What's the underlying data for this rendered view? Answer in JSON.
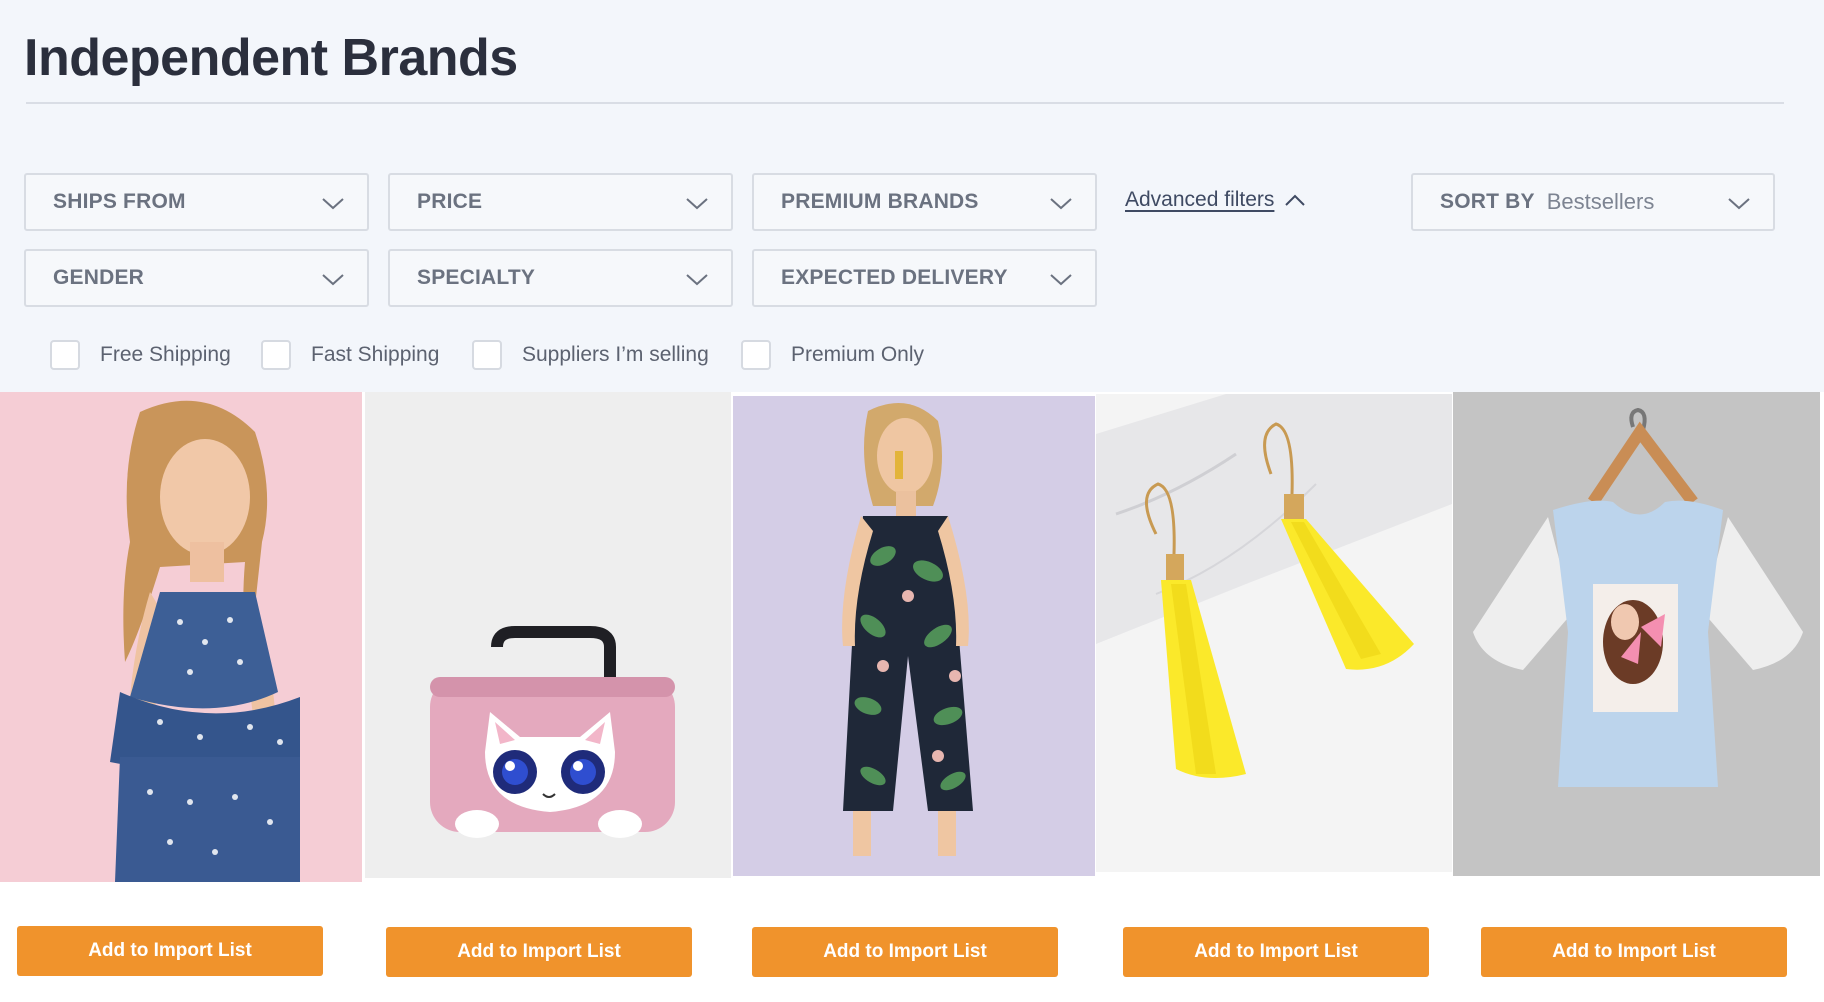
{
  "page": {
    "title": "Independent Brands"
  },
  "filters": {
    "row1": [
      {
        "label": "SHIPS FROM"
      },
      {
        "label": "PRICE"
      },
      {
        "label": "PREMIUM BRANDS"
      }
    ],
    "row2": [
      {
        "label": "GENDER"
      },
      {
        "label": "SPECIALTY"
      },
      {
        "label": "EXPECTED DELIVERY"
      }
    ],
    "advanced_label": "Advanced filters",
    "sort": {
      "label": "SORT BY",
      "value": "Bestsellers"
    }
  },
  "checkboxes": [
    {
      "label": "Free Shipping",
      "checked": false
    },
    {
      "label": "Fast Shipping",
      "checked": false
    },
    {
      "label": "Suppliers I’m selling",
      "checked": false
    },
    {
      "label": "Premium Only",
      "checked": false
    }
  ],
  "products": [
    {
      "image": "girl-polka-dot-outfit",
      "bg": "#f5cdd5",
      "button": "Add to Import List"
    },
    {
      "image": "pink-cat-handbag",
      "bg": "#eeeeee",
      "button": "Add to Import List"
    },
    {
      "image": "tropical-print-jumpsuit",
      "bg": "#d4cde6",
      "button": "Add to Import List"
    },
    {
      "image": "yellow-tassel-earrings",
      "bg": "#f4f4f4",
      "button": "Add to Import List"
    },
    {
      "image": "blue-graphic-tshirt",
      "bg": "#c4c4c4",
      "button": "Add to Import List"
    }
  ],
  "colors": {
    "accent": "#f0932c",
    "panel_bg": "#f3f6fb"
  }
}
